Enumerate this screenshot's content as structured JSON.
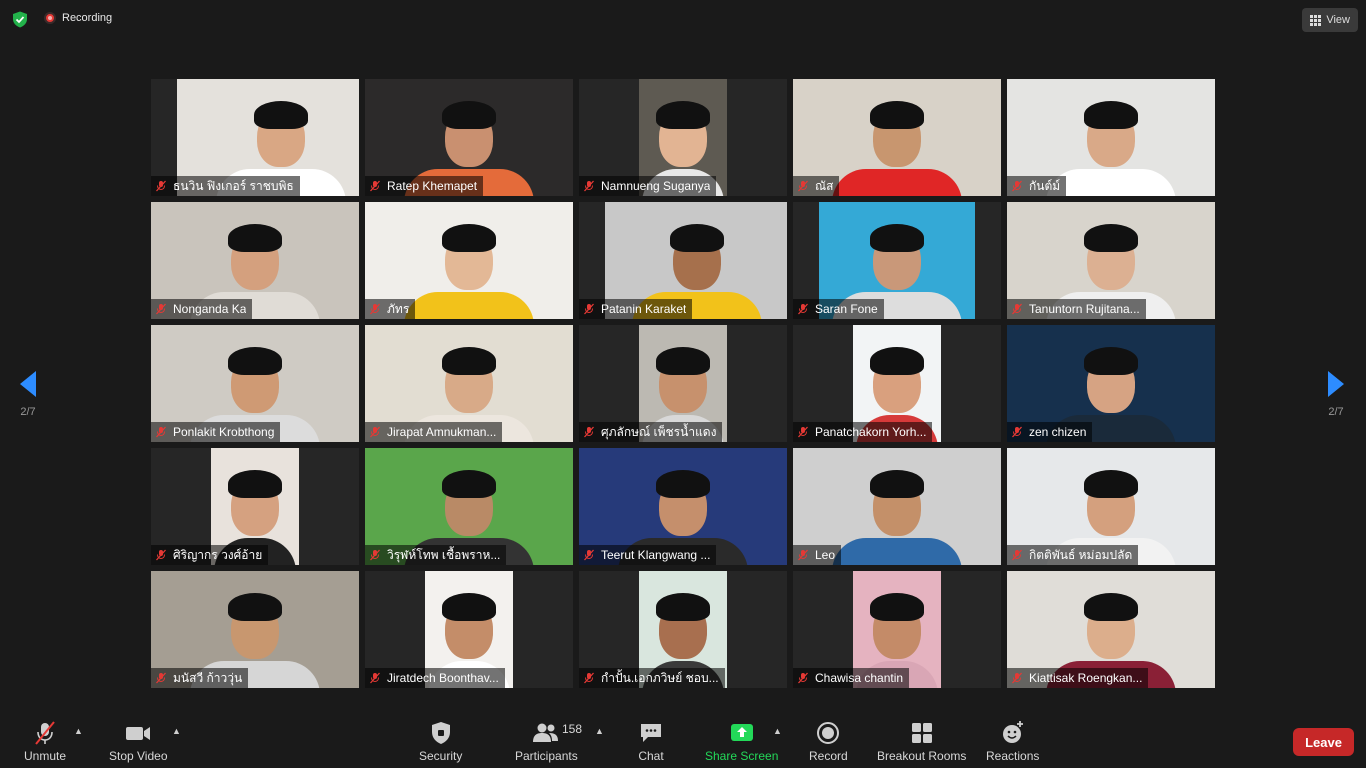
{
  "top": {
    "recording_label": "Recording",
    "view_label": "View"
  },
  "pager": {
    "left_label": "2/7",
    "right_label": "2/7"
  },
  "participants": [
    {
      "name": "ธนวิน ฟิงเกอร์ ราชบพิธ",
      "bg": "#e4e1dc",
      "skin": "#d9a784",
      "shirt": "#ffffff"
    },
    {
      "name": "Ratep Khemapet",
      "bg": "#2c2a2a",
      "skin": "#c99070",
      "shirt": "#e46b3a"
    },
    {
      "name": "Namnueng Suganya",
      "bg": "#5e5a52",
      "skin": "#e2b493",
      "shirt": "#e8e8e8"
    },
    {
      "name": "ณัส",
      "bg": "#d8d2c8",
      "skin": "#c8966f",
      "shirt": "#e02626"
    },
    {
      "name": "กันต์ม์",
      "bg": "#e4e4e2",
      "skin": "#d9a988",
      "shirt": "#ffffff"
    },
    {
      "name": "Nonganda Ka",
      "bg": "#c9c4bc",
      "skin": "#d4a07e",
      "shirt": "#e0dcd6"
    },
    {
      "name": "ภัทร",
      "bg": "#f0eeea",
      "skin": "#e3b896",
      "shirt": "#f2c21a"
    },
    {
      "name": "Patanin Karaket",
      "bg": "#c8c8c8",
      "skin": "#a6704c",
      "shirt": "#f2c21a"
    },
    {
      "name": "Saran Fone",
      "bg": "#34a9d6",
      "skin": "#c99879",
      "shirt": "#dddddd"
    },
    {
      "name": "Tanuntorn Rujitana...",
      "bg": "#d8d4cc",
      "skin": "#dcb092",
      "shirt": "#efefef"
    },
    {
      "name": "Ponlakit Krobthong",
      "bg": "#cfcbc4",
      "skin": "#cf9a74",
      "shirt": "#dcdcdc"
    },
    {
      "name": "Jirapat Amnukman...",
      "bg": "#e2ddd2",
      "skin": "#d8aa88",
      "shirt": "#ece6de"
    },
    {
      "name": "ศุภลักษณ์ เพ็ชรน้ำแดง",
      "bg": "#bcb9b2",
      "skin": "#c7916d",
      "shirt": "#d8d8d8"
    },
    {
      "name": "Panatchakorn Yorh...",
      "bg": "#f2f4f5",
      "skin": "#d9a07e",
      "shirt": "#d63a3a"
    },
    {
      "name": "zen chizen",
      "bg": "#16304d",
      "skin": "#d6a383",
      "shirt": "#1a2a3a"
    },
    {
      "name": "ศิริญากร วงศ์อ้าย",
      "bg": "#e8e2dc",
      "skin": "#d5a180",
      "shirt": "#222222"
    },
    {
      "name": "วิรุฬห์โทพ  เชื้อพราห...",
      "bg": "#5aa64b",
      "skin": "#b98a66",
      "shirt": "#333333"
    },
    {
      "name": "Teerut Klangwang ...",
      "bg": "#263a7a",
      "skin": "#c58f6c",
      "shirt": "#2a2a2a"
    },
    {
      "name": "Leo",
      "bg": "#cfcfcf",
      "skin": "#c49069",
      "shirt": "#2f6aa8"
    },
    {
      "name": "กิตติพันธ์ หม่อมปลัด",
      "bg": "#e6e8ea",
      "skin": "#d4a07e",
      "shirt": "#f2f2f2"
    },
    {
      "name": "มนัสวี ก้าววุ่น",
      "bg": "#a59e93",
      "skin": "#c8976f",
      "shirt": "#d6d6d6"
    },
    {
      "name": "Jiratdech Boonthav...",
      "bg": "#f3f1ee",
      "skin": "#c48d69",
      "shirt": "#ffffff"
    },
    {
      "name": "กำปั้น.เอกภวิษย์  ชอบ...",
      "bg": "#d9e6de",
      "skin": "#a86f4f",
      "shirt": "#3a3a3a"
    },
    {
      "name": "Chawisa chantin",
      "bg": "#e5b3c0",
      "skin": "#c48b68",
      "shirt": "#d9a6b5"
    },
    {
      "name": "Kiattisak Roengkan...",
      "bg": "#e0ddd8",
      "skin": "#dcae8c",
      "shirt": "#8a2036"
    }
  ],
  "toolbar": {
    "unmute": "Unmute",
    "stop_video": "Stop Video",
    "security": "Security",
    "participants": "Participants",
    "participants_count": "158",
    "chat": "Chat",
    "share_screen": "Share Screen",
    "record": "Record",
    "breakout_rooms": "Breakout Rooms",
    "reactions": "Reactions",
    "leave": "Leave"
  },
  "colors": {
    "accent_green": "#23d959",
    "leave_red": "#c62828",
    "arrow_blue": "#2d8cff",
    "mute_red": "#e53935"
  }
}
